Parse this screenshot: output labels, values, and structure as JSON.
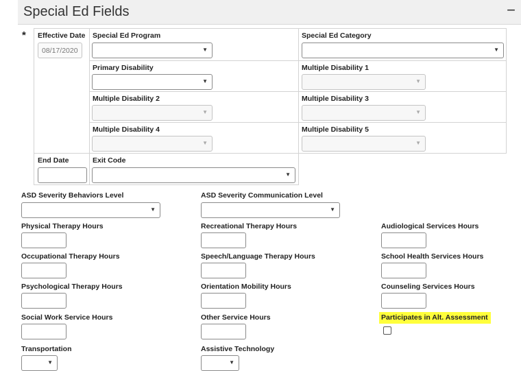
{
  "section": {
    "title": "Special Ed Fields",
    "collapse_glyph": "−"
  },
  "required_marker": "*",
  "arrow_glyph": "▼",
  "grid": {
    "effective_date_label": "Effective Date",
    "effective_date_value": "08/17/2020",
    "special_ed_program_label": "Special Ed Program",
    "special_ed_category_label": "Special Ed Category",
    "primary_disability_label": "Primary Disability",
    "multiple_disability_1_label": "Multiple Disability 1",
    "multiple_disability_2_label": "Multiple Disability 2",
    "multiple_disability_3_label": "Multiple Disability 3",
    "multiple_disability_4_label": "Multiple Disability 4",
    "multiple_disability_5_label": "Multiple Disability 5",
    "end_date_label": "End Date",
    "exit_code_label": "Exit Code"
  },
  "fields": {
    "asd_behaviors": "ASD Severity Behaviors Level",
    "asd_communication": "ASD Severity Communication Level",
    "physical_therapy": "Physical Therapy Hours",
    "recreational_therapy": "Recreational Therapy Hours",
    "audiological_services": "Audiological Services Hours",
    "occupational_therapy": "Occupational Therapy Hours",
    "speech_language_therapy": "Speech/Language Therapy Hours",
    "school_health_services": "School Health Services Hours",
    "psychological_therapy": "Psychological Therapy Hours",
    "orientation_mobility": "Orientation Mobility Hours",
    "counseling_services": "Counseling Services Hours",
    "social_work_service": "Social Work Service Hours",
    "other_service": "Other Service Hours",
    "participates_alt_assessment": "Participates in Alt. Assessment",
    "transportation": "Transportation",
    "assistive_technology": "Assistive Technology"
  },
  "colors": {
    "highlight": "#ffff3c",
    "header_bg": "#f0f0f0"
  }
}
